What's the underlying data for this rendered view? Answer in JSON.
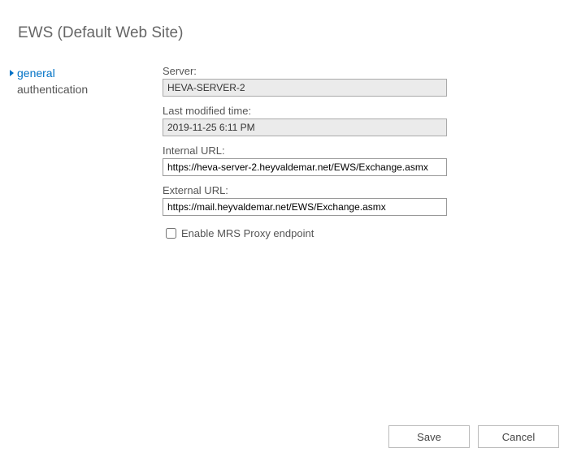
{
  "title": "EWS (Default Web Site)",
  "sidebar": {
    "items": [
      {
        "label": "general",
        "active": true
      },
      {
        "label": "authentication",
        "active": false
      }
    ]
  },
  "panel": {
    "server_label": "Server:",
    "server_value": "HEVA-SERVER-2",
    "last_modified_label": "Last modified time:",
    "last_modified_value": "2019-11-25 6:11 PM",
    "internal_url_label": "Internal URL:",
    "internal_url_value": "https://heva-server-2.heyvaldemar.net/EWS/Exchange.asmx",
    "external_url_label": "External URL:",
    "external_url_value": "https://mail.heyvaldemar.net/EWS/Exchange.asmx",
    "mrs_label": "Enable MRS Proxy endpoint",
    "mrs_checked": false
  },
  "footer": {
    "save_label": "Save",
    "cancel_label": "Cancel"
  }
}
